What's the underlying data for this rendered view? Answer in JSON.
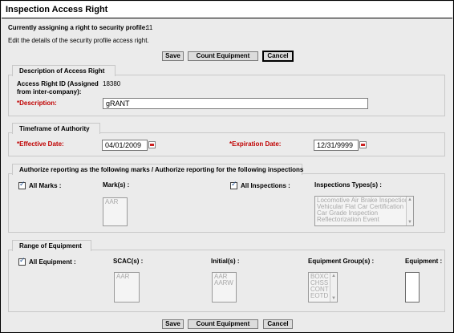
{
  "window": {
    "title": "Inspection Access Right"
  },
  "profile": {
    "label": "Currently assigning a right to security profile:",
    "value": "11",
    "instruction": "Edit the details of the security profile access right."
  },
  "buttons": {
    "save": "Save",
    "count": "Count Equipment",
    "cancel": "Cancel"
  },
  "description_section": {
    "title": "Description of Access Right",
    "id_label_1": "Access Right ID (Assigned",
    "id_label_2": "from inter-company):",
    "id_value": "18380",
    "description_label": "*Description:",
    "description_value": "gRANT"
  },
  "timeframe_section": {
    "title": "Timeframe of Authority",
    "effective_label": "*Effective Date:",
    "effective_value": "04/01/2009",
    "expiration_label": "*Expiration Date:",
    "expiration_value": "12/31/9999"
  },
  "authorize_section": {
    "title": "Authorize reporting as the following marks / Authorize reporting for the following inspections",
    "all_marks_label": "All Marks :",
    "marks_label": "Mark(s) :",
    "marks_options": [
      "AAR"
    ],
    "all_inspections_label": "All Inspections :",
    "inspection_types_label": "Inspections Types(s) :",
    "inspection_options": [
      "Locomotive Air Brake Inspection",
      "Vehicular Flat Car Certification",
      "Car Grade Inspection",
      "Reflectorization Event"
    ]
  },
  "range_section": {
    "title": "Range of Equipment",
    "all_equipment_label": "All Equipment :",
    "scac_label": "SCAC(s) :",
    "scac_options": [
      "AAR"
    ],
    "initial_label": "Initial(s) :",
    "initial_options": [
      "AAR",
      "AARW"
    ],
    "group_label": "Equipment Group(s) :",
    "group_options": [
      "BOXC",
      "CHSS",
      "CONT",
      "EOTD"
    ],
    "equipment_label": "Equipment :"
  },
  "colors": {
    "required": "#c00000",
    "panel": "#ebebeb",
    "check": "#2a5b9a"
  }
}
